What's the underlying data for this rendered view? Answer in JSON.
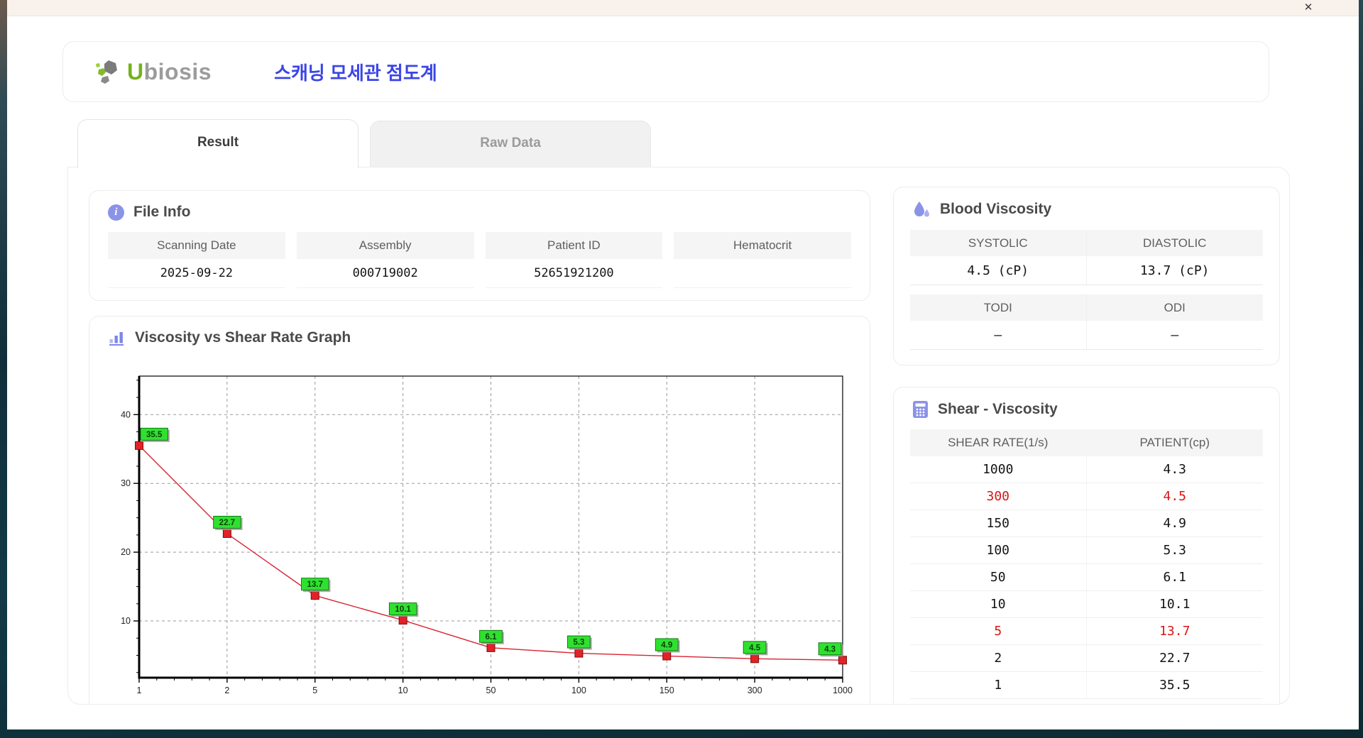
{
  "titlebar": {
    "close_label": "✕"
  },
  "header": {
    "logo_u": "U",
    "logo_rest": "biosis",
    "app_title": "스캐닝 모세관 점도계"
  },
  "tabs": {
    "result": "Result",
    "raw_data": "Raw Data"
  },
  "file_info": {
    "title": "File Info",
    "columns": [
      {
        "label": "Scanning Date",
        "value": "2025-09-22"
      },
      {
        "label": "Assembly",
        "value": "000719002"
      },
      {
        "label": "Patient ID",
        "value": "52651921200"
      },
      {
        "label": "Hematocrit",
        "value": ""
      }
    ]
  },
  "blood_viscosity": {
    "title": "Blood Viscosity",
    "systolic": {
      "label": "SYSTOLIC",
      "value": "4.5 (cP)"
    },
    "diastolic": {
      "label": "DIASTOLIC",
      "value": "13.7 (cP)"
    },
    "todi": {
      "label": "TODI",
      "value": "–"
    },
    "odi": {
      "label": "ODI",
      "value": "–"
    }
  },
  "shear_viscosity": {
    "title": "Shear - Viscosity",
    "col_headers": [
      "SHEAR RATE(1/s)",
      "PATIENT(cp)"
    ],
    "highlight_color": "#dc1414",
    "rows": [
      {
        "shear": "1000",
        "patient": "4.3",
        "highlight": false
      },
      {
        "shear": "300",
        "patient": "4.5",
        "highlight": true
      },
      {
        "shear": "150",
        "patient": "4.9",
        "highlight": false
      },
      {
        "shear": "100",
        "patient": "5.3",
        "highlight": false
      },
      {
        "shear": "50",
        "patient": "6.1",
        "highlight": false
      },
      {
        "shear": "10",
        "patient": "10.1",
        "highlight": false
      },
      {
        "shear": "5",
        "patient": "13.7",
        "highlight": true
      },
      {
        "shear": "2",
        "patient": "22.7",
        "highlight": false
      },
      {
        "shear": "1",
        "patient": "35.5",
        "highlight": false
      }
    ]
  },
  "graph_section": {
    "title": "Viscosity vs Shear Rate Graph"
  },
  "chart_data": {
    "type": "line",
    "title": "Viscosity vs Shear Rate Graph",
    "categories": [
      "1",
      "2",
      "5",
      "10",
      "50",
      "100",
      "150",
      "300",
      "1000"
    ],
    "values": [
      35.5,
      22.7,
      13.7,
      10.1,
      6.1,
      5.3,
      4.9,
      4.5,
      4.3
    ],
    "x_scale": "categorical-evenly-spaced",
    "xlabel": "",
    "ylabel": "",
    "yticks": [
      10,
      20,
      30,
      40
    ],
    "ylim": [
      1.75,
      45.6
    ],
    "grid": true,
    "legend": false,
    "line_color": "#d92330",
    "marker": {
      "shape": "square",
      "size": 11,
      "fill": "#e32227",
      "stroke": "#7a0c0c"
    },
    "point_labels": {
      "bg": "#2fe12f",
      "border": "#157815",
      "text_color": "#0a3f0a",
      "shadow": "#9a9a9a"
    }
  },
  "icons": {
    "close-icon": "window close x",
    "logo-icon": "ubiosis hexagon-leaf mark",
    "info-icon": "info i in circle",
    "chart-bars-icon": "bar chart",
    "droplets-icon": "two blood drops",
    "calculator-icon": "calculator"
  },
  "colors": {
    "accent_purple": "#8b93e8",
    "title_blue": "#3b45e6",
    "logo_green": "#76b11c",
    "logo_gray": "#9c9c9c",
    "highlight_red": "#dc1414",
    "header_cell_bg": "#f5f5f6"
  }
}
